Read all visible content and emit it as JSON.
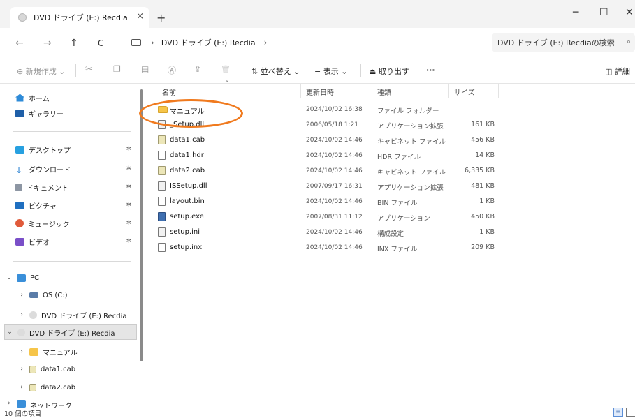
{
  "window": {
    "tab_title": "DVD ドライブ (E:) Recdia",
    "tab_close": "×",
    "new_tab": "+",
    "minimize": "─",
    "maximize": "☐",
    "close": "✕"
  },
  "nav": {
    "back": "←",
    "forward": "→",
    "up": "↑",
    "refresh": "C",
    "breadcrumb_sep": "›",
    "breadcrumb": "DVD ドライブ (E:) Recdia",
    "breadcrumb_tail": "›",
    "search_placeholder": "DVD ドライブ (E:) Recdiaの検索",
    "search_icon": "⌕"
  },
  "toolbar": {
    "new_label": "⊕ 新規作成 ⌄",
    "cut_icon": "✂",
    "copy_icon": "❐",
    "paste_icon": "▤",
    "rename_icon": "Ⓐ",
    "share_icon": "⇪",
    "delete_icon": "🗑",
    "sort_label": "⇅ 並べ替え ⌄",
    "view_label": "≡ 表示 ⌄",
    "eject_label": "⏏ 取り出す",
    "more_label": "···",
    "details_label": "◫ 詳細"
  },
  "sidebar": {
    "home": "ホーム",
    "gallery": "ギャラリー",
    "desktop": "デスクトップ",
    "downloads": "ダウンロード",
    "documents": "ドキュメント",
    "pictures": "ピクチャ",
    "music": "ミュージック",
    "videos": "ビデオ",
    "pin": "✲",
    "pc": "PC",
    "os": "OS (C:)",
    "dvd": "DVD ドライブ (E:) Recdia",
    "dvd_selected": "DVD ドライブ (E:) Recdia",
    "manual": "マニュアル",
    "data1": "data1.cab",
    "data2": "data2.cab",
    "network": "ネットワーク",
    "expand": "›",
    "collapse": "⌄"
  },
  "columns": {
    "name": "名前",
    "date": "更新日時",
    "type": "種類",
    "size": "サイズ",
    "sort_caret": "^"
  },
  "files": [
    {
      "name": "マニュアル",
      "date": "2024/10/02 16:38",
      "type": "ファイル フォルダー",
      "size": ""
    },
    {
      "name": "_Setup.dll",
      "date": "2006/05/18 1:21",
      "type": "アプリケーション拡張",
      "size": "161 KB"
    },
    {
      "name": "data1.cab",
      "date": "2024/10/02 14:46",
      "type": "キャビネット ファイル",
      "size": "456 KB"
    },
    {
      "name": "data1.hdr",
      "date": "2024/10/02 14:46",
      "type": "HDR ファイル",
      "size": "14 KB"
    },
    {
      "name": "data2.cab",
      "date": "2024/10/02 14:46",
      "type": "キャビネット ファイル",
      "size": "6,335 KB"
    },
    {
      "name": "ISSetup.dll",
      "date": "2007/09/17 16:31",
      "type": "アプリケーション拡張",
      "size": "481 KB"
    },
    {
      "name": "layout.bin",
      "date": "2024/10/02 14:46",
      "type": "BIN ファイル",
      "size": "1 KB"
    },
    {
      "name": "setup.exe",
      "date": "2007/08/31 11:12",
      "type": "アプリケーション",
      "size": "450 KB"
    },
    {
      "name": "setup.ini",
      "date": "2024/10/02 14:46",
      "type": "構成設定",
      "size": "1 KB"
    },
    {
      "name": "setup.inx",
      "date": "2024/10/02 14:46",
      "type": "INX ファイル",
      "size": "209 KB"
    }
  ],
  "status": {
    "count": "10 個の項目",
    "view_icon": "≡"
  },
  "colors": {
    "highlight": "#f07a1e",
    "folder": "#f6c54a",
    "selection": "#e5e5e5"
  }
}
